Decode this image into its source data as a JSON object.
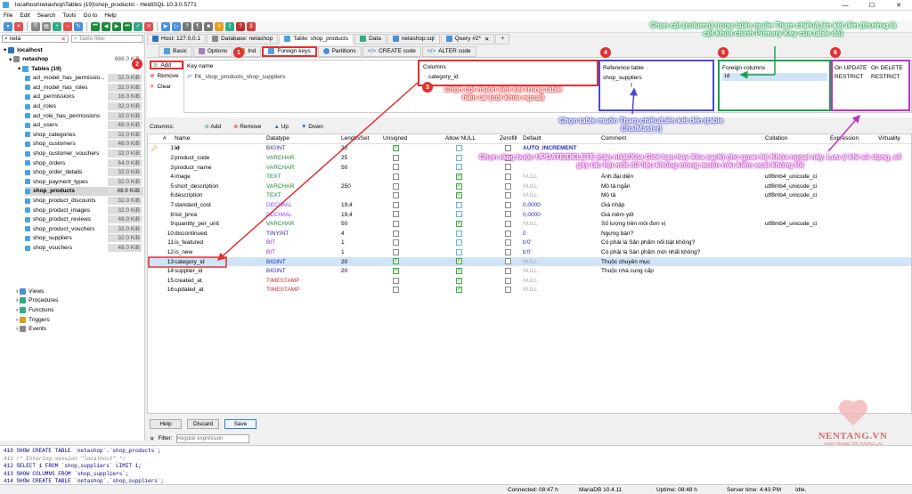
{
  "window": {
    "title": "localhost\\netashop\\Tables (19)\\shop_products\\ - HeidiSQL 10.3.0.5771"
  },
  "menu": [
    "File",
    "Edit",
    "Search",
    "Tools",
    "Go to",
    "Help"
  ],
  "left": {
    "db_filter": "neta",
    "table_filter_placeholder": "Table filter",
    "root": "localhost",
    "db": "netashop",
    "db_size": "688.0 KiB",
    "tables_label": "Tables (19)",
    "tables": [
      {
        "name": "acl_model_has_permissio...",
        "size": "32.0 KiB"
      },
      {
        "name": "acl_model_has_roles",
        "size": "32.0 KiB"
      },
      {
        "name": "acl_permissions",
        "size": "16.0 KiB"
      },
      {
        "name": "acl_roles",
        "size": "32.0 KiB"
      },
      {
        "name": "acl_role_has_permissions",
        "size": "32.0 KiB"
      },
      {
        "name": "acl_users",
        "size": "48.0 KiB"
      },
      {
        "name": "shop_categories",
        "size": "32.0 KiB"
      },
      {
        "name": "shop_customers",
        "size": "48.0 KiB"
      },
      {
        "name": "shop_customer_vouchers",
        "size": "32.0 KiB"
      },
      {
        "name": "shop_orders",
        "size": "64.0 KiB"
      },
      {
        "name": "shop_order_details",
        "size": "32.0 KiB"
      },
      {
        "name": "shop_payment_types",
        "size": "32.0 KiB"
      },
      {
        "name": "shop_products",
        "size": "48.0 KiB"
      },
      {
        "name": "shop_product_discounts",
        "size": "32.0 KiB"
      },
      {
        "name": "shop_product_images",
        "size": "32.0 KiB"
      },
      {
        "name": "shop_product_reviews",
        "size": "48.0 KiB"
      },
      {
        "name": "shop_product_vouchers",
        "size": "32.0 KiB"
      },
      {
        "name": "shop_suppliers",
        "size": "32.0 KiB"
      },
      {
        "name": "shop_vouchers",
        "size": "48.0 KiB"
      }
    ],
    "others": [
      "Views",
      "Procedures",
      "Functions",
      "Triggers",
      "Events"
    ]
  },
  "tabs": [
    "Host: 127.0.0.1",
    "Database: netashop",
    "Table: shop_products",
    "Data",
    "netashop.sql",
    "Query #2*"
  ],
  "subtabs": [
    "Basic",
    "Options",
    "Ind",
    "Foreign keys",
    "Partitions",
    "CREATE code",
    "ALTER code"
  ],
  "fk": {
    "add": "Add",
    "remove": "Remove",
    "clear": "Clear",
    "headers": {
      "key_name": "Key name",
      "columns": "Columns",
      "ref_table": "Reference table",
      "foreign_columns": "Foreign columns",
      "on_update": "On UPDATE",
      "on_delete": "On DELETE"
    },
    "row": {
      "key_name": "FK_shop_products_shop_suppliers",
      "columns": "category_id",
      "ref_table": "shop_suppliers",
      "foreign_columns": "id",
      "on_update": "RESTRICT",
      "on_delete": "RESTRICT"
    }
  },
  "columns_bar": {
    "label": "Columns:",
    "add": "Add",
    "remove": "Remove",
    "up": "Up",
    "down": "Down"
  },
  "grid_headers": [
    "#",
    "Name",
    "Datatype",
    "Length/Set",
    "Unsigned",
    "Allow NULL",
    "Zerofill",
    "Default",
    "Comment",
    "Collation",
    "Expression",
    "Virtuality"
  ],
  "rows": [
    {
      "n": "1",
      "name": "id",
      "type": "BIGINT",
      "len": "20",
      "uns": true,
      "nul": false,
      "zf": false,
      "def": "AUTO_INCREMENT",
      "com": "",
      "col": ""
    },
    {
      "n": "2",
      "name": "product_code",
      "type": "VARCHAR",
      "len": "25",
      "uns": false,
      "nul": false,
      "zf": false,
      "def": "",
      "com": "",
      "col": ""
    },
    {
      "n": "3",
      "name": "product_name",
      "type": "VARCHAR",
      "len": "50",
      "uns": false,
      "nul": false,
      "zf": false,
      "def": "",
      "com": "",
      "col": ""
    },
    {
      "n": "4",
      "name": "image",
      "type": "TEXT",
      "len": "",
      "uns": false,
      "nul": true,
      "zf": false,
      "def": "NULL",
      "com": "Ảnh đại diện",
      "col": "utf8mb4_unicode_ci"
    },
    {
      "n": "5",
      "name": "short_description",
      "type": "VARCHAR",
      "len": "250",
      "uns": false,
      "nul": true,
      "zf": false,
      "def": "NULL",
      "com": "Mô tả ngắn",
      "col": "utf8mb4_unicode_ci"
    },
    {
      "n": "6",
      "name": "description",
      "type": "TEXT",
      "len": "",
      "uns": false,
      "nul": true,
      "zf": false,
      "def": "NULL",
      "com": "Mô tả",
      "col": "utf8mb4_unicode_ci"
    },
    {
      "n": "7",
      "name": "standard_cost",
      "type": "DECIMAL",
      "len": "19,4",
      "uns": false,
      "nul": false,
      "zf": false,
      "def": "0,0000",
      "com": "Giá nhập",
      "col": ""
    },
    {
      "n": "8",
      "name": "list_price",
      "type": "DECIMAL",
      "len": "19,4",
      "uns": false,
      "nul": false,
      "zf": false,
      "def": "0,0000",
      "com": "Giá niêm yết",
      "col": ""
    },
    {
      "n": "9",
      "name": "quantity_per_unit",
      "type": "VARCHAR",
      "len": "50",
      "uns": false,
      "nul": true,
      "zf": false,
      "def": "NULL",
      "com": "Số lượng trên mỗi đơn vị",
      "col": "utf8mb4_unicode_ci"
    },
    {
      "n": "10",
      "name": "discontinued",
      "type": "TINYINT",
      "len": "4",
      "uns": false,
      "nul": false,
      "zf": false,
      "def": "0",
      "com": "Ngưng bán?",
      "col": ""
    },
    {
      "n": "11",
      "name": "is_featured",
      "type": "BIT",
      "len": "1",
      "uns": false,
      "nul": false,
      "zf": false,
      "def": "b'0'",
      "com": "Có phải là Sản phẩm nổi bật không?",
      "col": ""
    },
    {
      "n": "12",
      "name": "is_new",
      "type": "BIT",
      "len": "1",
      "uns": false,
      "nul": false,
      "zf": false,
      "def": "b'0'",
      "com": "Có phải là Sản phẩm mới nhất không?",
      "col": ""
    },
    {
      "n": "13",
      "name": "category_id",
      "type": "BIGINT",
      "len": "20",
      "uns": true,
      "nul": true,
      "zf": false,
      "def": "NULL",
      "com": "Thuộc chuyên mục",
      "col": ""
    },
    {
      "n": "14",
      "name": "supplier_id",
      "type": "BIGINT",
      "len": "20",
      "uns": true,
      "nul": true,
      "zf": false,
      "def": "NULL",
      "com": "Thuộc nhà cung cấp",
      "col": ""
    },
    {
      "n": "15",
      "name": "created_at",
      "type": "TIMESTAMP",
      "len": "",
      "uns": false,
      "nul": true,
      "zf": false,
      "def": "NULL",
      "com": "",
      "col": ""
    },
    {
      "n": "16",
      "name": "updated_at",
      "type": "TIMESTAMP",
      "len": "",
      "uns": false,
      "nul": true,
      "zf": false,
      "def": "NULL",
      "com": "",
      "col": ""
    }
  ],
  "buttons": {
    "help": "Help",
    "discard": "Discard",
    "save": "Save"
  },
  "filter": {
    "label": "Filter:",
    "placeholder": "Regular expression"
  },
  "log": [
    "410 SHOW CREATE TABLE `netashop`.`shop_products`;",
    "411 /* Entering session \"localhost\" */",
    "412 SELECT 1 FROM `shop_suppliers` LIMIT 1;",
    "413 SHOW COLUMNS FROM `shop_suppliers`;",
    "414 SHOW CREATE TABLE `netashop`.`shop_suppliers`;"
  ],
  "status": {
    "connected": "Connected: 08:47 h",
    "server": "MariaDB 10.4.11",
    "uptime": "Uptime: 08:48 h",
    "server_time": "Server time: 4:43 PM",
    "idle": "Idle."
  },
  "annotations": {
    "n1": "1",
    "n2": "2",
    "n3": "3",
    "n4": "4",
    "n5": "5",
    "n6": "6",
    "a3": "Chọn cột muốn liên kết trong table hiện tại (cột khóa ngoại)",
    "a4": "Chọn table muốn Tham chiếu/Liên kết đến (table Cha/Master)",
    "a5": "Chọn cột (column) trong table muốn Tham chiếu/Liên kết đến (thường là cột khóa chính Primary Key của table đó)",
    "a6": "Chọn ràng buộc UPDATE/DELETE (cập nhật/Xóa Giới hạn hay Xóa sạch) cho quan hệ Khóa ngoại này. Lưu ý khi sử dụng, sẽ gây tác hại mất dữ liệu không mong muốn nếu kiểm soát không tốt"
  },
  "watermark": {
    "brand": "NENTANG.VN",
    "tagline": "HÀNH TRANG TỚI TƯƠNG LAI"
  },
  "colors": {
    "accent_red": "#e03030",
    "annot_green": "#1aa34a",
    "annot_blue": "#4a4ad0",
    "annot_purple": "#c030c0"
  }
}
